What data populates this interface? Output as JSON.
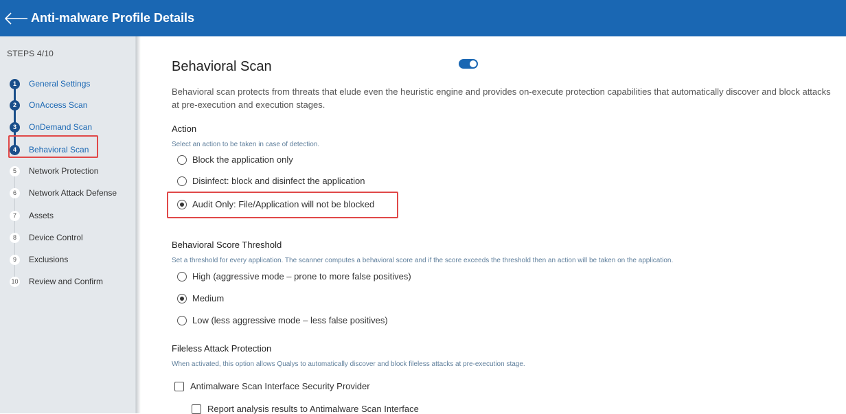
{
  "header": {
    "title": "Anti-malware Profile Details",
    "back_icon": "arrow-left-icon"
  },
  "sidebar": {
    "steps_label": "STEPS 4/10",
    "steps": [
      {
        "num": "1",
        "label": "General Settings",
        "state": "done"
      },
      {
        "num": "2",
        "label": "OnAccess Scan",
        "state": "done"
      },
      {
        "num": "3",
        "label": "OnDemand Scan",
        "state": "done"
      },
      {
        "num": "4",
        "label": "Behavioral Scan",
        "state": "active"
      },
      {
        "num": "5",
        "label": "Network Protection",
        "state": "todo"
      },
      {
        "num": "6",
        "label": "Network Attack Defense",
        "state": "todo"
      },
      {
        "num": "7",
        "label": "Assets",
        "state": "todo"
      },
      {
        "num": "8",
        "label": "Device Control",
        "state": "todo"
      },
      {
        "num": "9",
        "label": "Exclusions",
        "state": "todo"
      },
      {
        "num": "10",
        "label": "Review and Confirm",
        "state": "todo"
      }
    ]
  },
  "main": {
    "title": "Behavioral Scan",
    "enabled": true,
    "description": "Behavioral scan protects from threats that elude even the heuristic engine and provides on-execute protection capabilities that automatically discover and block attacks at pre-execution and execution stages.",
    "action": {
      "heading": "Action",
      "hint": "Select an action to be taken in case of detection.",
      "options": [
        {
          "label": "Block the application only",
          "checked": false
        },
        {
          "label": "Disinfect: block and disinfect the application",
          "checked": false
        },
        {
          "label": "Audit Only: File/Application will not be blocked",
          "checked": true
        }
      ]
    },
    "threshold": {
      "heading": "Behavioral Score Threshold",
      "hint": "Set a threshold for every application. The scanner computes a behavioral score and if the score exceeds the threshold then an action will be taken on the application.",
      "options": [
        {
          "label": "High (aggressive mode – prone to more false positives)",
          "checked": false
        },
        {
          "label": "Medium",
          "checked": true
        },
        {
          "label": "Low (less aggressive mode – less false positives)",
          "checked": false
        }
      ]
    },
    "fileless": {
      "heading": "Fileless Attack Protection",
      "hint": "When activated, this option allows Qualys to automatically discover and block fileless attacks at pre-execution stage.",
      "options": [
        {
          "label": "Antimalware Scan Interface Security Provider",
          "checked": false
        },
        {
          "label": "Report analysis results to Antimalware Scan Interface",
          "checked": false
        }
      ]
    }
  },
  "colors": {
    "header": "#1a67b3",
    "step_done": "#1a4f8a",
    "highlight": "#e04848"
  }
}
